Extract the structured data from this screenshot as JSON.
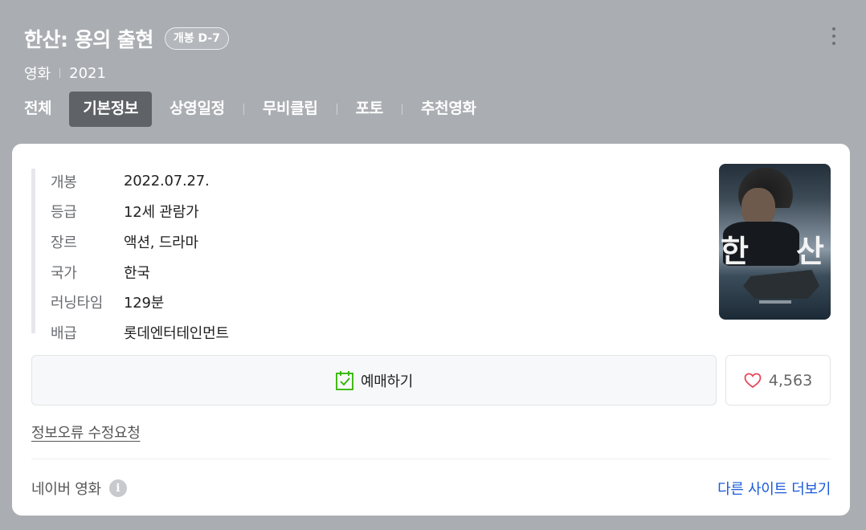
{
  "header": {
    "title": "한산: 용의 출현",
    "badge": "개봉 D-7",
    "category": "영화",
    "year": "2021"
  },
  "tabs": [
    {
      "label": "전체",
      "active": false
    },
    {
      "label": "기본정보",
      "active": true
    },
    {
      "label": "상영일정",
      "active": false
    },
    {
      "label": "무비클립",
      "active": false
    },
    {
      "label": "포토",
      "active": false
    },
    {
      "label": "추천영화",
      "active": false
    }
  ],
  "info": [
    {
      "label": "개봉",
      "value": "2022.07.27."
    },
    {
      "label": "등급",
      "value": "12세 관람가"
    },
    {
      "label": "장르",
      "value": "액션, 드라마"
    },
    {
      "label": "국가",
      "value": "한국"
    },
    {
      "label": "러닝타임",
      "value": "129분"
    },
    {
      "label": "배급",
      "value": "롯데엔터테인먼트"
    }
  ],
  "poster": {
    "glyph_left": "한",
    "glyph_right": "산"
  },
  "actions": {
    "reserve_label": "예매하기",
    "like_count": "4,563"
  },
  "report_link": "정보오류 수정요청",
  "footer": {
    "source": "네이버 영화",
    "info_icon": "i",
    "more_sites": "다른 사이트 더보기"
  },
  "colors": {
    "background": "#aaadb2",
    "active_tab": "#5f6267",
    "link": "#1a5ad9",
    "heart": "#e8475c",
    "calendar_check": "#2db400"
  }
}
